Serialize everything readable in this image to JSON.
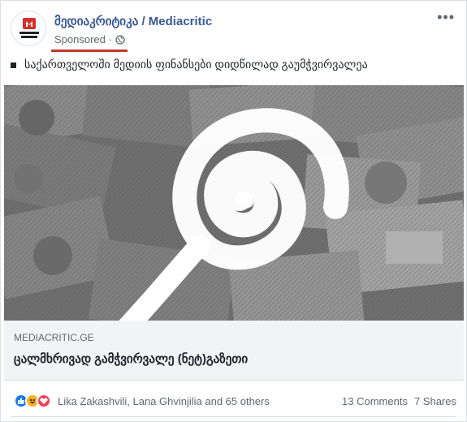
{
  "post": {
    "page_name": "მედიაკრიტიკა / Mediacritic",
    "sponsored": "Sponsored",
    "more_label": "•••",
    "text": "საქართველოში მედიის ფინანსები დიდწილად გაუმჭვირვალეა",
    "avatar_logo_text": "მედია კრიტიკა"
  },
  "link": {
    "domain": "MEDIACRITIC.GE",
    "headline": "ცალმხრივად გამჭვირვალე (ნეტ)გაზეთი"
  },
  "engagement": {
    "reactions": [
      "like-icon",
      "haha-icon",
      "love-icon"
    ],
    "names": "Lika Zakashvili, Lana Ghvinjilia and 65 others",
    "comments": "13 Comments",
    "shares": "7 Shares"
  },
  "colors": {
    "link_blue": "#385898",
    "underline_red": "#c0392b",
    "like_blue": "#1877f2",
    "haha_yellow": "#f7b125",
    "love_red": "#f33e58"
  }
}
